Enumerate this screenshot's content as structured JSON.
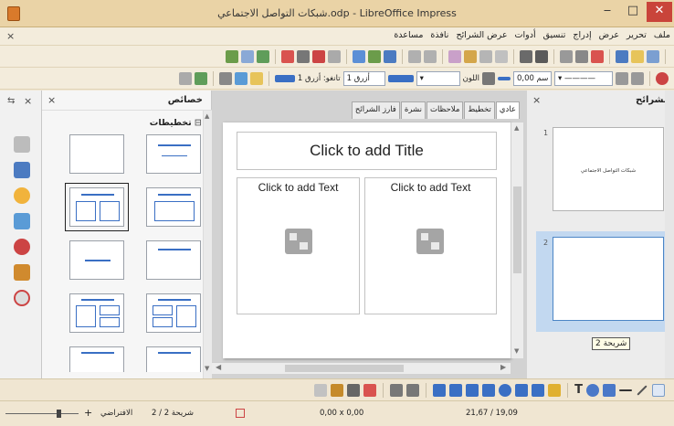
{
  "window": {
    "title": "شبكات التواصل الاجتماعي.odp - LibreOffice Impress",
    "minimize": "‒",
    "maximize": "□",
    "close": "✕"
  },
  "menubar": {
    "close_doc": "×",
    "items": [
      "ملف",
      "تحرير",
      "عرض",
      "إدراج",
      "تنسيق",
      "أدوات",
      "عرض الشرائح",
      "نافذة",
      "مساعدة"
    ]
  },
  "toolbar2": {
    "area_label": "اللون",
    "line_width": "0,00 سم",
    "line_color": "أزرق 1",
    "fill_label": "تانغو: أزرق 1"
  },
  "properties_panel": {
    "title": "خصائص",
    "close": "×",
    "section": "تخطيطات",
    "selected_layout_index": 2
  },
  "doc_tabs": [
    "عادي",
    "تخطيط",
    "ملاحظات",
    "نشرة",
    "فارز الشرائح"
  ],
  "active_doc_tab": "عادي",
  "slide": {
    "title_placeholder": "Click to add Title",
    "text_left": "Click to add Text",
    "text_right": "Click to add Text"
  },
  "slides_pane": {
    "title": "الشرائح",
    "close": "×",
    "slides": [
      {
        "number": "1",
        "text": "شبكات التواصل الاجتماعي"
      },
      {
        "number": "2",
        "text": ""
      }
    ],
    "tooltip": "شريحة 2"
  },
  "statusbar": {
    "position": "0,00 x 0,00",
    "size": "21,67 / 19,09",
    "slide_of": "شريحة 2 / 2",
    "master": "الافتراضي"
  },
  "colors": {
    "titlebar": "#ead3a6",
    "close_button": "#c9443a",
    "layout_accent": "#3a6fc4",
    "selected_thumb": "#c2d8f0"
  }
}
